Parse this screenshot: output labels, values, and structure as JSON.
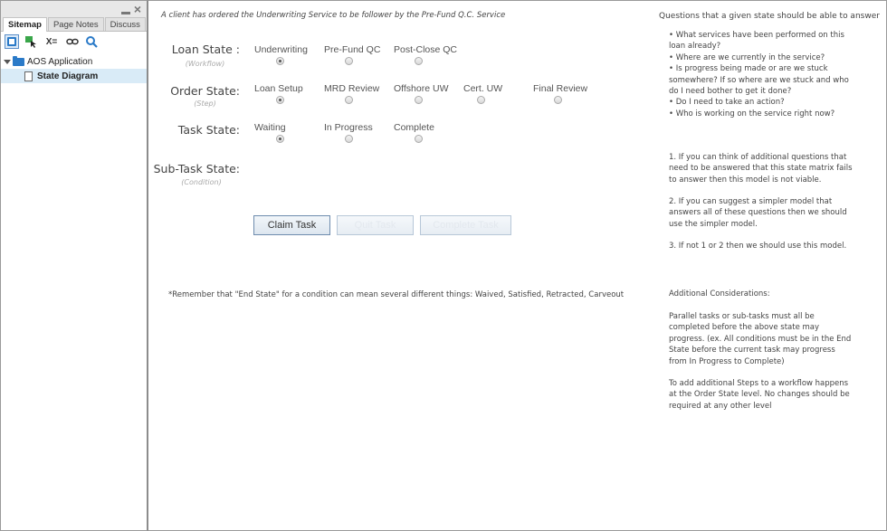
{
  "sidebar": {
    "tabs": [
      "Sitemap",
      "Page Notes",
      "Discuss"
    ],
    "toolbar_icons": [
      "page-view-icon",
      "add-page-icon",
      "variables-icon",
      "link-icon",
      "search-icon"
    ],
    "variables_label": "X=",
    "tree": {
      "root": "AOS Application",
      "child": "State Diagram"
    }
  },
  "main": {
    "intro": "A client has ordered the Underwriting Service to be follower by the Pre-Fund Q.C. Service",
    "states": [
      {
        "label": "Loan State :",
        "sub": "(Workflow)",
        "options": [
          {
            "label": "Underwriting",
            "selected": true
          },
          {
            "label": "Pre-Fund QC",
            "selected": false
          },
          {
            "label": "Post-Close QC",
            "selected": false
          }
        ]
      },
      {
        "label": "Order State:",
        "sub": "(Step)",
        "options": [
          {
            "label": "Loan Setup",
            "selected": true
          },
          {
            "label": "MRD Review",
            "selected": false
          },
          {
            "label": "Offshore UW",
            "selected": false
          },
          {
            "label": "Cert. UW",
            "selected": false
          },
          {
            "label": "Final Review",
            "selected": false
          }
        ]
      },
      {
        "label": "Task State:",
        "sub": "",
        "options": [
          {
            "label": "Waiting",
            "selected": true
          },
          {
            "label": "In Progress",
            "selected": false
          },
          {
            "label": "Complete",
            "selected": false
          }
        ]
      },
      {
        "label": "Sub-Task State:",
        "sub": "(Condition)",
        "options": []
      }
    ],
    "buttons": [
      {
        "label": "Claim Task",
        "enabled": true
      },
      {
        "label": "Quit Task",
        "enabled": false
      },
      {
        "label": "Complete Task",
        "enabled": false
      }
    ],
    "remember": "*Remember that \"End State\" for a condition can mean several different things: Waived, Satisfied, Retracted, Carveout",
    "questions_title": "Questions that a given state should be able to answer",
    "questions": [
      "• What services have been performed on this loan already?",
      "• Where are we currently in the service?",
      "• Is progress being made or are we stuck somewhere? If so where are we stuck and who do I need bother to get it done?",
      "• Do I need to take an action?",
      "• Who is working on the service right now?"
    ],
    "notes": [
      "1. If you can think of additional questions that need to be answered that this state matrix fails to answer then this model is not viable.",
      "2. If you can suggest a simpler model that answers all of these questions then we should use the simpler model.",
      "3. If not 1 or 2 then we should use this model."
    ],
    "additional_title": "Additional Considerations:",
    "additional": [
      "Parallel tasks or sub-tasks must all be completed before the above state may progress. (ex. All conditions must be in the End State before the current task may progress from In Progress to Complete)",
      "To add additional Steps to a workflow happens at the Order State level. No changes should be required at any other level"
    ]
  }
}
